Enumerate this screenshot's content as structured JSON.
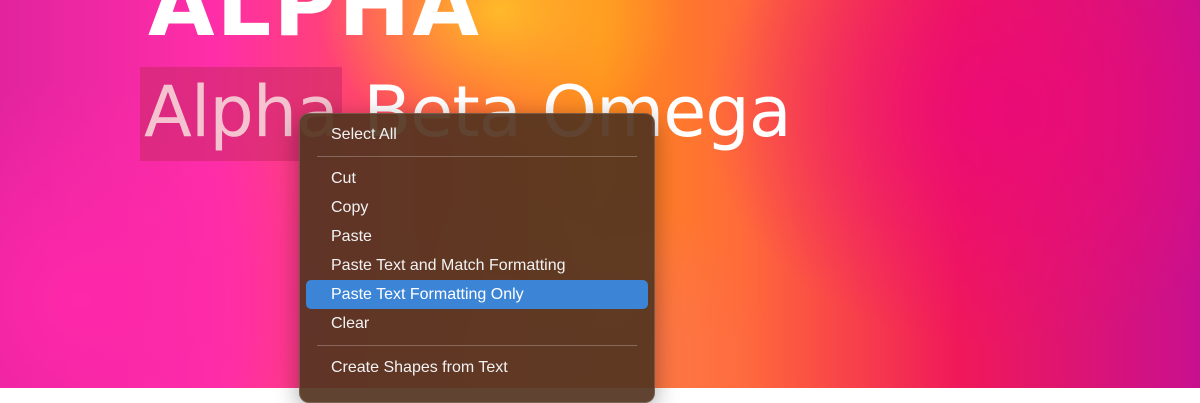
{
  "title": {
    "heading": "ALPHA",
    "subheading_selected": "Alpha",
    "subheading_rest": " Beta Omega"
  },
  "context_menu": {
    "sections": [
      [
        "Select All"
      ],
      [
        "Cut",
        "Copy",
        "Paste",
        "Paste Text and Match Formatting",
        "Paste Text Formatting Only",
        "Clear"
      ],
      [
        "Create Shapes from Text"
      ]
    ],
    "highlighted_item": "Paste Text Formatting Only"
  },
  "colors": {
    "menu_highlight": "#3b84d6",
    "menu_background": "#523420",
    "selection": "#c82864"
  }
}
